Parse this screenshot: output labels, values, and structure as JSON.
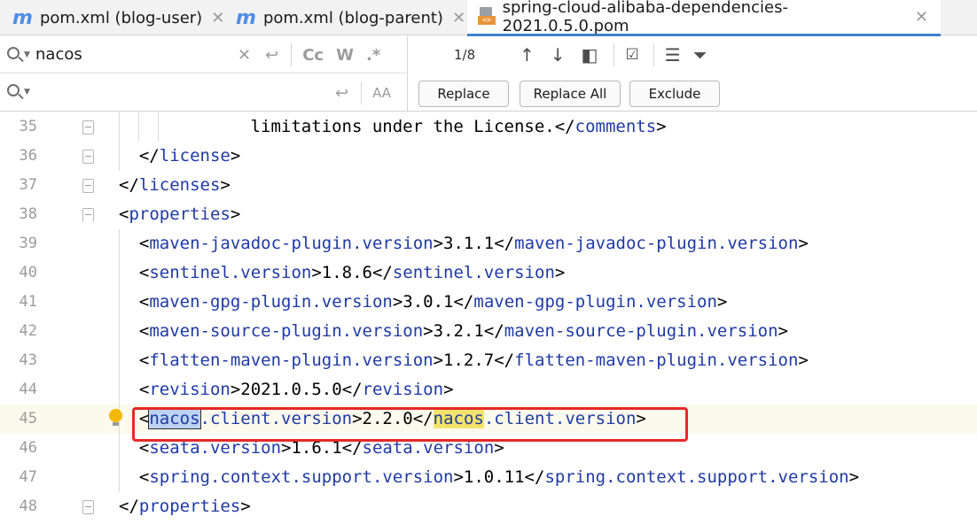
{
  "tabs": [
    {
      "icon": "m",
      "label": "pom.xml (blog-user)"
    },
    {
      "icon": "m",
      "label": "pom.xml (blog-parent)"
    },
    {
      "icon": "<>",
      "label": "spring-cloud-alibaba-dependencies-2021.0.5.0.pom"
    }
  ],
  "find": {
    "query": "nacos",
    "match_case": "Cc",
    "whole_word": "W",
    "regex": ".*",
    "match_count": "1/8"
  },
  "replace": {
    "query": "",
    "preserve_case": "AA",
    "replace_label": "Replace",
    "replace_all_label": "Replace All",
    "exclude_label": "Exclude"
  },
  "editor": {
    "current_line": 45,
    "lines": [
      {
        "num": "35",
        "indent": "             ",
        "text": "limitations under the License.",
        "close": "comments"
      },
      {
        "num": "36",
        "indent": "  ",
        "close_only": "license"
      },
      {
        "num": "37",
        "indent": "",
        "close_only": "licenses"
      },
      {
        "num": "38",
        "indent": "",
        "open_only": "properties"
      },
      {
        "num": "39",
        "indent": "  ",
        "tag": "maven-javadoc-plugin.version",
        "value": "3.1.1"
      },
      {
        "num": "40",
        "indent": "  ",
        "tag": "sentinel.version",
        "value": "1.8.6"
      },
      {
        "num": "41",
        "indent": "  ",
        "tag": "maven-gpg-plugin.version",
        "value": "3.0.1"
      },
      {
        "num": "42",
        "indent": "  ",
        "tag": "maven-source-plugin.version",
        "value": "3.2.1"
      },
      {
        "num": "43",
        "indent": "  ",
        "tag": "flatten-maven-plugin.version",
        "value": "1.2.7"
      },
      {
        "num": "44",
        "indent": "  ",
        "tag": "revision",
        "value": "2021.0.5.0"
      },
      {
        "num": "45",
        "indent": "  ",
        "tag_match": "nacos",
        "tag_rest": ".client.version",
        "value": "2.2.0"
      },
      {
        "num": "46",
        "indent": "  ",
        "tag": "seata.version",
        "value": "1.6.1"
      },
      {
        "num": "47",
        "indent": "  ",
        "tag": "spring.context.support.version",
        "value": "1.0.11"
      },
      {
        "num": "48",
        "indent": "",
        "close_only": "properties"
      }
    ]
  }
}
